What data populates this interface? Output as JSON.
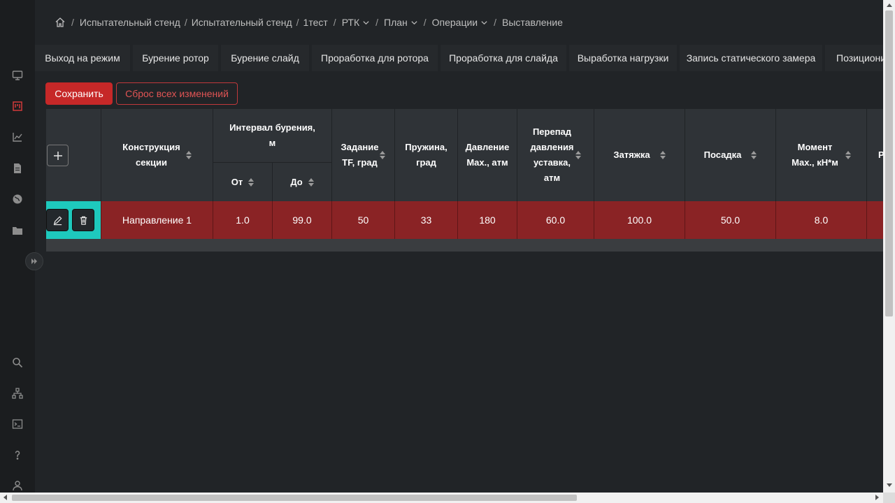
{
  "breadcrumb": {
    "items": [
      {
        "label": "Испытательный стенд",
        "dropdown": false
      },
      {
        "label": "Испытательный стенд",
        "dropdown": false
      },
      {
        "label": "1тест",
        "dropdown": false
      },
      {
        "label": "РТК",
        "dropdown": true
      },
      {
        "label": "План",
        "dropdown": true
      },
      {
        "label": "Операции",
        "dropdown": true
      },
      {
        "label": "Выставление",
        "dropdown": false
      }
    ]
  },
  "tabs": [
    "Выход на режим",
    "Бурение ротор",
    "Бурение слайд",
    "Проработка для ротора",
    "Проработка для слайда",
    "Выработка нагрузки",
    "Запись статического замера",
    "Позиционирование"
  ],
  "actions": {
    "save_label": "Сохранить",
    "reset_label": "Сброс всех изменений"
  },
  "table": {
    "headers": {
      "section": [
        "Конструкция",
        "секции"
      ],
      "interval": [
        "Интервал бурения,",
        "м"
      ],
      "from": "От",
      "to": "До",
      "tf": [
        "Задание",
        "TF, град"
      ],
      "spring": [
        "Пружина,",
        "град"
      ],
      "pressure": [
        "Давление",
        "Max., атм"
      ],
      "diff": [
        "Перепад",
        "давления",
        "уставка,",
        "атм"
      ],
      "pull": "Затяжка",
      "set": "Посадка",
      "torque": [
        "Момент",
        "Max., кН*м"
      ],
      "next": "Р"
    },
    "rows": [
      {
        "section": "Направление 1",
        "from": "1.0",
        "to": "99.0",
        "tf": "50",
        "spring": "33",
        "pressure": "180",
        "diff": "60.0",
        "pull": "100.0",
        "set": "50.0",
        "torque": "8.0"
      }
    ]
  },
  "colors": {
    "accent": "#c62828",
    "row_highlight": "#8a2325",
    "action_cell": "#1ec9bd",
    "background": "#212427"
  }
}
